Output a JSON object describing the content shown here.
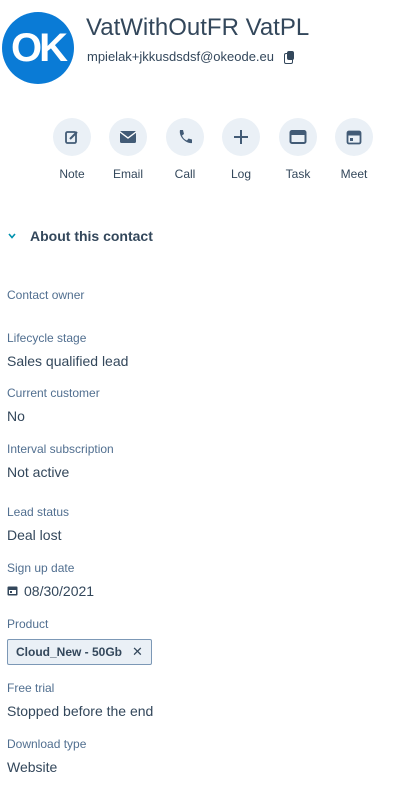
{
  "contact": {
    "avatar_text": "OK",
    "name": "VatWithOutFR VatPL",
    "email": "mpielak+jkkusdsdsf@okeode.eu"
  },
  "actions": [
    {
      "label": "Note",
      "icon": "note-icon"
    },
    {
      "label": "Email",
      "icon": "email-icon"
    },
    {
      "label": "Call",
      "icon": "call-icon"
    },
    {
      "label": "Log",
      "icon": "plus-icon"
    },
    {
      "label": "Task",
      "icon": "task-icon"
    },
    {
      "label": "Meet",
      "icon": "calendar-icon"
    }
  ],
  "section": {
    "title": "About this contact"
  },
  "properties": {
    "owner": {
      "label": "Contact owner",
      "value": ""
    },
    "lifecycle": {
      "label": "Lifecycle stage",
      "value": "Sales qualified lead"
    },
    "customer": {
      "label": "Current customer",
      "value": "No"
    },
    "subscription": {
      "label": "Interval subscription",
      "value": "Not active"
    },
    "lead_status": {
      "label": "Lead status",
      "value": "Deal lost"
    },
    "signup": {
      "label": "Sign up date",
      "value": "08/30/2021"
    },
    "product": {
      "label": "Product",
      "value": "Cloud_New - 50Gb"
    },
    "free_trial": {
      "label": "Free trial",
      "value": "Stopped before the end"
    },
    "download": {
      "label": "Download type",
      "value": "Website"
    }
  },
  "colors": {
    "accent": "#0a7bd6",
    "text": "#33475b",
    "icon_bg": "#eaf0f6"
  }
}
